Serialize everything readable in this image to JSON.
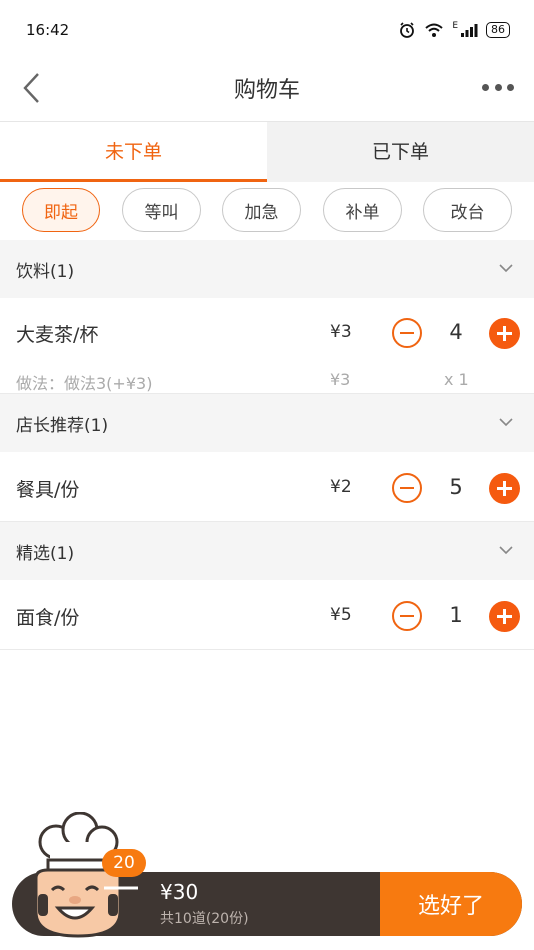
{
  "status_bar": {
    "time": "16:42",
    "network": "E",
    "battery": "86"
  },
  "nav": {
    "title": "购物车"
  },
  "tabs": [
    {
      "label": "未下单",
      "active": true
    },
    {
      "label": "已下单",
      "active": false
    }
  ],
  "chips": [
    "即起",
    "等叫",
    "加急",
    "补单",
    "改台"
  ],
  "sections": [
    {
      "title": "饮料(1)",
      "item": {
        "name": "大麦茶/杯",
        "price": "¥3",
        "qty": "4",
        "option": "做法：做法3(+¥3)",
        "option_price": "¥3",
        "option_qty": "x 1"
      }
    },
    {
      "title": "店长推荐(1)",
      "item": {
        "name": "餐具/份",
        "price": "¥2",
        "qty": "5"
      }
    },
    {
      "title": "精选(1)",
      "item": {
        "name": "面食/份",
        "price": "¥5",
        "qty": "1"
      }
    }
  ],
  "cart": {
    "badge": "20",
    "total": "¥30",
    "count": "共10道(20份)",
    "checkout": "选好了"
  },
  "colors": {
    "accent": "#f06411",
    "cart_bar": "#3e3632",
    "checkout": "#f77a10"
  },
  "icons": {
    "back": "chevron-left-icon",
    "more": "more-dots-icon",
    "chevron": "chevron-down-icon",
    "minus": "minus-circle-icon",
    "plus": "plus-circle-icon",
    "chef": "chef-mascot-icon"
  }
}
